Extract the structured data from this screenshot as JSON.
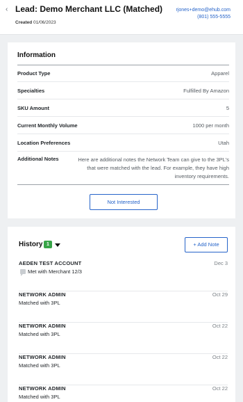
{
  "header": {
    "back_glyph": "‹",
    "title": "Lead: Demo Merchant LLC  (Matched)",
    "created_label": "Created",
    "created_date": "01/06/2023",
    "email": "rjones+demo@ehub.com",
    "phone": "(801) 555-5555"
  },
  "information": {
    "title": "Information",
    "rows": [
      {
        "label": "Product Type",
        "value": "Apparel"
      },
      {
        "label": "Specialties",
        "value": "Fulfilled By Amazon"
      },
      {
        "label": "SKU Amount",
        "value": "5"
      },
      {
        "label": "Current Monthly Volume",
        "value": "1000 per month"
      },
      {
        "label": "Location Preferences",
        "value": "Utah"
      }
    ],
    "notes_label": "Additional Notes",
    "notes_value": "Here are additional notes the Network Team can give to the 3PL's that were matched with the lead. For example, they have high inventory requirements.",
    "not_interested_label": "Not Interested"
  },
  "history": {
    "title": "History",
    "count": "1",
    "add_note_label": "+ Add Note",
    "items": [
      {
        "name": "AEDEN TEST ACCOUNT",
        "description": "Met with Merchant 12/3",
        "date": "Dec 3",
        "icon": "comment-icon"
      },
      {
        "name": "NETWORK ADMIN",
        "description": "Matched with 3PL",
        "date": "Oct 29"
      },
      {
        "name": "NETWORK ADMIN",
        "description": "Matched with 3PL",
        "date": "Oct 22"
      },
      {
        "name": "NETWORK ADMIN",
        "description": "Matched with 3PL",
        "date": "Oct 22"
      },
      {
        "name": "NETWORK ADMIN",
        "description": "Matched with 3PL",
        "date": "Oct 22"
      }
    ]
  }
}
